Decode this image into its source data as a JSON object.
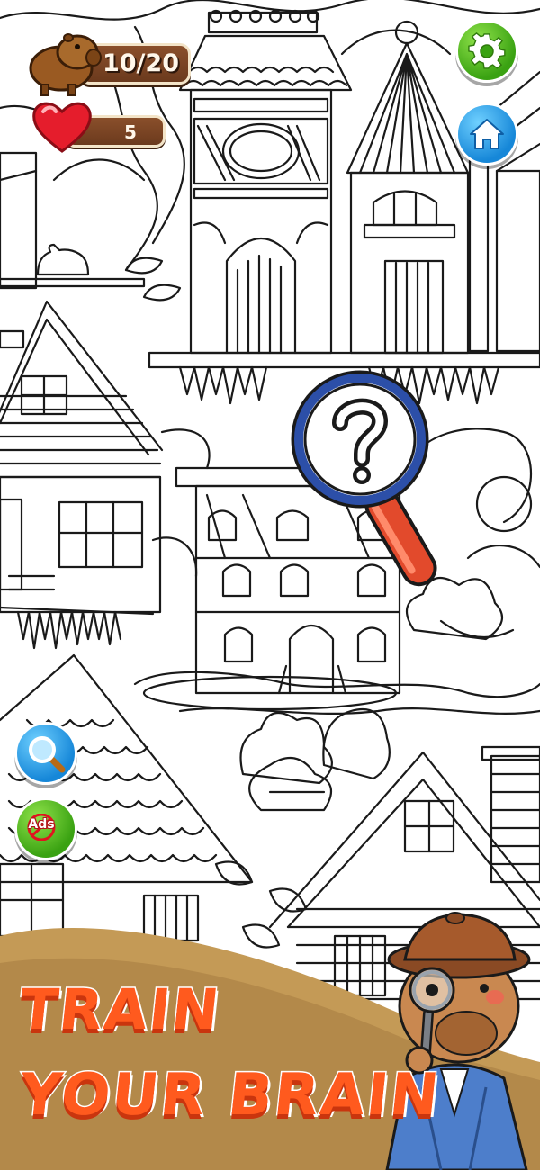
{
  "hud": {
    "found_counter": "10/20",
    "found_icon": "capybara-icon",
    "lives": "5",
    "lives_icon": "heart-icon"
  },
  "buttons": {
    "settings_icon": "gear-icon",
    "home_icon": "home-icon",
    "hint_icon": "magnifier-icon",
    "ads_label": "Ads"
  },
  "promo": {
    "line1": "TRAIN",
    "line2": "YOUR BRAIN"
  },
  "colors": {
    "accent_green": "#3aa212",
    "accent_blue": "#1687d8",
    "promo_orange": "#ff5a1e",
    "hud_brown": "#7a4424",
    "magnifier_handle": "#e24a2c",
    "magnifier_rim": "#2c4fa8"
  }
}
